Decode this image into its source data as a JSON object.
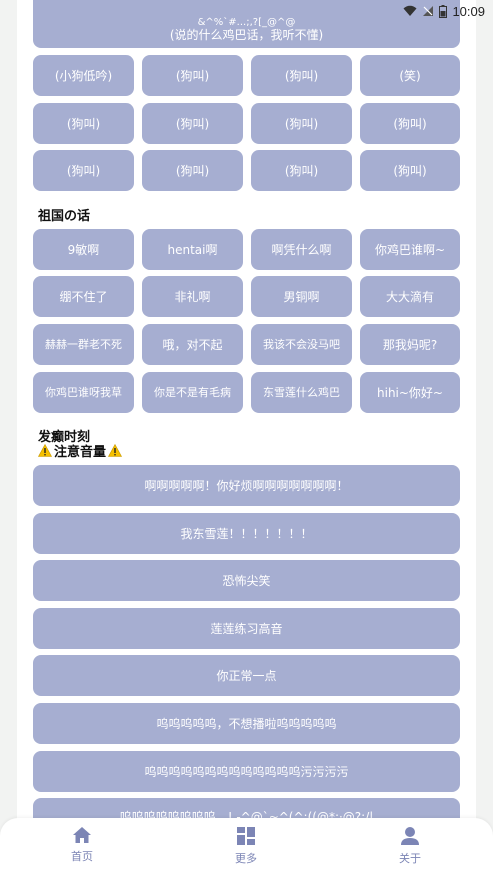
{
  "status_bar": {
    "time": "10:09"
  },
  "top_partial": {
    "line1": "&^%`#...;,?[_@^@",
    "line2": "(说的什么鸡巴话，我听不懂)"
  },
  "row_grid_a": [
    [
      "(小狗低吟)",
      "(狗叫)",
      "(狗叫)",
      "(笑)"
    ],
    [
      "(狗叫)",
      "(狗叫)",
      "(狗叫)",
      "(狗叫)"
    ],
    [
      "(狗叫)",
      "(狗叫)",
      "(狗叫)",
      "(狗叫)"
    ]
  ],
  "section_motherland": {
    "title": "祖国の话",
    "rows": [
      [
        "9敏啊",
        "hentai啊",
        "啊凭什么啊",
        "你鸡巴谁啊~"
      ],
      [
        "绷不住了",
        "非礼啊",
        "男铜啊",
        "大大滴有"
      ],
      [
        "赫赫一群老不死",
        "哦，对不起",
        "我该不会没马吧",
        "那我妈呢?"
      ],
      [
        "你鸡巴谁呀我草",
        "你是不是有毛病",
        "东雪莲什么鸡巴",
        "hihi~你好~"
      ]
    ]
  },
  "section_madness": {
    "title": "发癫时刻",
    "warning": "注意音量",
    "items": [
      "啊啊啊啊啊！你好烦啊啊啊啊啊啊啊！",
      "我东雪莲！！！！！！！",
      "恐怖尖笑",
      "莲莲练习高音",
      "你正常一点",
      "呜呜呜呜呜，不想播啦呜呜呜呜呜",
      "呜呜呜呜呜呜呜呜呜呜呜呜呜污污污污",
      "呜呜呜呜呜呜呜呜，!.-^@`~^(^;((@*;·@?:/|"
    ]
  },
  "bottom_nav": [
    {
      "label": "首页",
      "icon": "home-icon"
    },
    {
      "label": "更多",
      "icon": "grid-icon"
    },
    {
      "label": "关于",
      "icon": "person-icon"
    }
  ],
  "colors": {
    "button": "#a6aed1",
    "nav": "#7c85b5",
    "background": "#f2f3f2"
  }
}
